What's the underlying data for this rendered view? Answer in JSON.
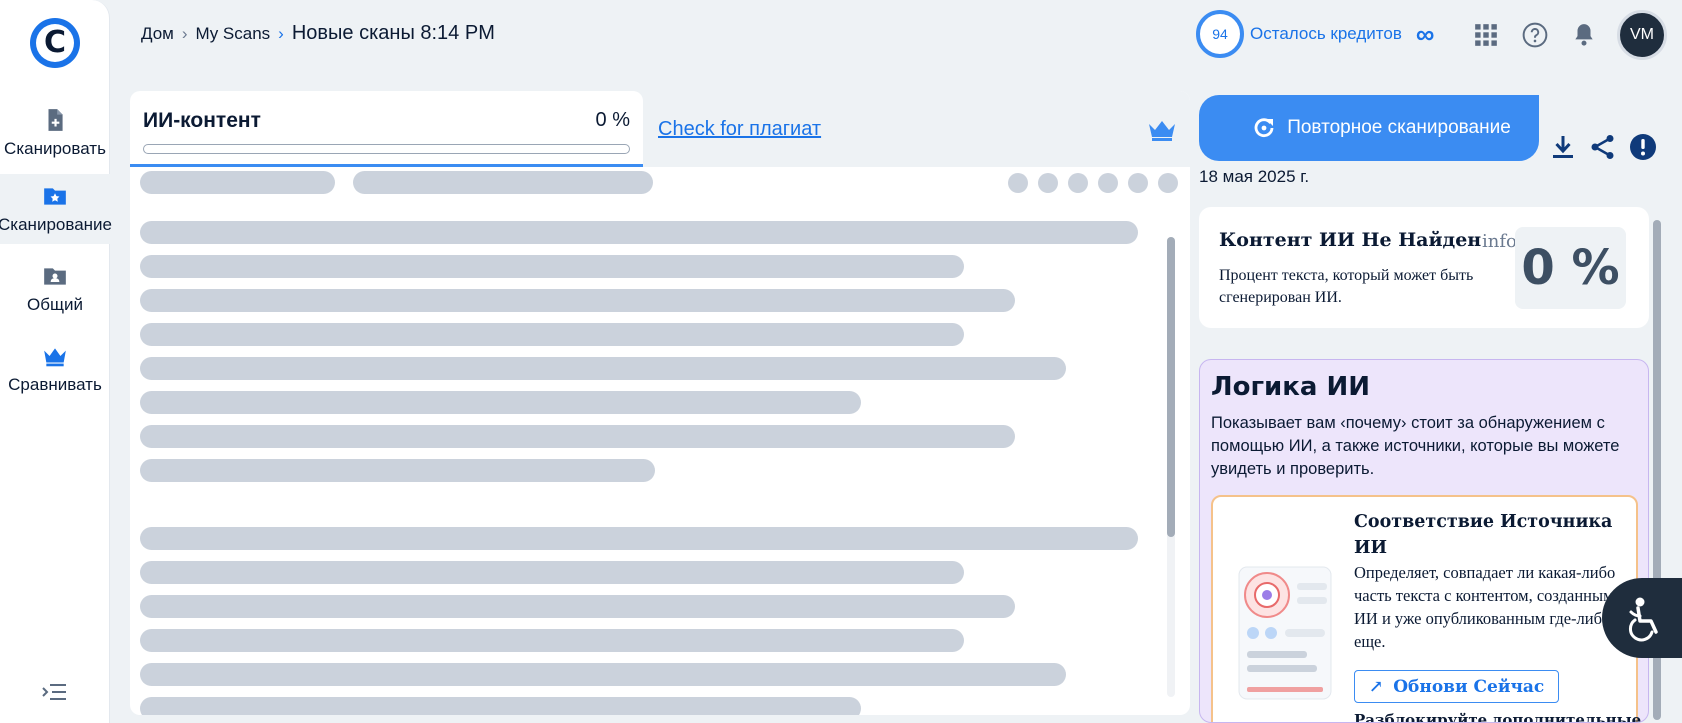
{
  "sidebar": {
    "logo_letter": "C",
    "items": [
      {
        "label": "Сканировать",
        "icon": "file-plus-icon"
      },
      {
        "label": "Сканирование",
        "icon": "folder-star-icon"
      },
      {
        "label": "Общий",
        "icon": "shared-folder-icon"
      },
      {
        "label": "Сравнивать",
        "icon": "crown-icon"
      }
    ],
    "collapse_icon": "collapse-menu-icon"
  },
  "header": {
    "breadcrumb": [
      "Дом",
      "My Scans"
    ],
    "current": "Новые сканы 8:14 PM",
    "credits_value": "94",
    "credits_label": "Осталось кредитов",
    "credits_unlimited": "∞",
    "icons": [
      "apps-grid-icon",
      "help-icon",
      "bell-icon"
    ],
    "avatar_initials": "VM"
  },
  "tabs": {
    "ai_title": "ИИ-контент",
    "ai_percent": "0 %",
    "ai_progress": 0,
    "plagiarism_link": "Check for плагиат",
    "premium_icon": "crown-icon"
  },
  "actions": {
    "rescan_label": "Повторное сканирование",
    "date": "18 мая 2025 г.",
    "icons": [
      "download-icon",
      "share-icon",
      "report-icon"
    ]
  },
  "result": {
    "title": "Контент ИИ Не Найден",
    "info": "info",
    "description": "Процент текста, который может быть сгенерирован ИИ.",
    "percent": "0 %"
  },
  "logic": {
    "title": "Логика ИИ",
    "description": "Показывает вам ‹почему› стоит за обнаружением с помощью ИИ, а также источники, которые вы можете увидеть и проверить.",
    "source_card": {
      "title": "Соответствие Источника ИИ",
      "description": "Определяет, совпадает ли какая-либо часть текста с контентом, созданным ИИ и уже опубликованным где-либо еще.",
      "button_label": "Обнови Сейчас",
      "more_text": "Разблокируйте дополнительные"
    }
  },
  "colors": {
    "accent": "#3b8cf2",
    "skeleton": "#cbd2dc",
    "logic_bg": "#ede5fb",
    "source_border": "#f5c28a",
    "dark": "#1f2d3d"
  }
}
